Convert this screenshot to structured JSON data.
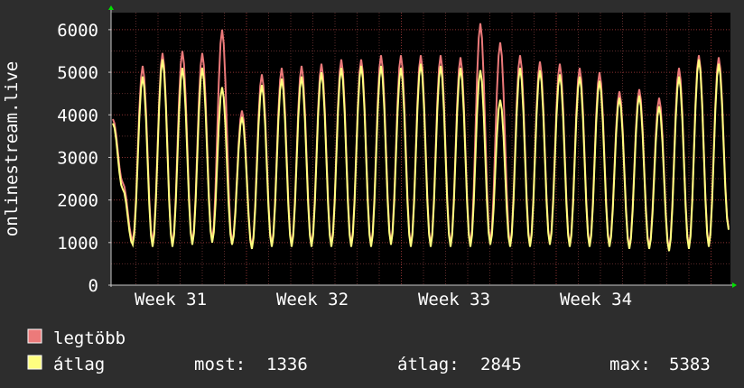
{
  "colors": {
    "background": "#2d2d2d",
    "plot_background": "#000000",
    "grid_minor": "#5a2a2a",
    "grid_major": "#8b3232",
    "max_series": "#ec7a7a",
    "avg_series": "#ffff80",
    "axis": "#c8c8c8",
    "arrow": "#00e000"
  },
  "chart_data": {
    "type": "line",
    "ylabel": "onlinestream.live",
    "ylim": [
      0,
      6400
    ],
    "yticks": [
      0,
      1000,
      2000,
      3000,
      4000,
      5000,
      6000
    ],
    "xlabels": [
      "Week 31",
      "Week 32",
      "Week 33",
      "Week 34"
    ],
    "grid": true,
    "series": [
      {
        "name": "legtöbb",
        "values": [
          3900,
          2400,
          1050,
          5150,
          1000,
          5450,
          950,
          5500,
          1000,
          5450,
          1050,
          6000,
          1000,
          4100,
          900,
          4950,
          950,
          5100,
          950,
          5150,
          950,
          5200,
          950,
          5300,
          950,
          5300,
          950,
          5400,
          1000,
          5400,
          950,
          5400,
          950,
          5400,
          950,
          5350,
          950,
          6150,
          1000,
          5700,
          950,
          5400,
          950,
          5250,
          1000,
          5200,
          950,
          5100,
          950,
          5000,
          950,
          4550,
          900,
          4600,
          900,
          4400,
          850,
          5100,
          900,
          5400,
          950,
          5350,
          1350
        ]
      },
      {
        "name": "átlag",
        "values": [
          3800,
          2250,
          950,
          4900,
          900,
          5300,
          900,
          5100,
          950,
          5100,
          1000,
          4650,
          950,
          3950,
          850,
          4700,
          900,
          4850,
          900,
          4900,
          900,
          5000,
          900,
          5100,
          900,
          5150,
          900,
          5150,
          950,
          5100,
          900,
          5200,
          900,
          5150,
          900,
          5100,
          900,
          5050,
          950,
          4350,
          900,
          5100,
          900,
          5050,
          950,
          4950,
          900,
          4900,
          900,
          4800,
          900,
          4400,
          850,
          4450,
          850,
          4200,
          800,
          4900,
          850,
          5300,
          900,
          5200,
          1300
        ]
      }
    ],
    "legend": {
      "max_label": "legtöbb",
      "avg_label": "átlag",
      "now_label": "most:",
      "now_value": "1336",
      "avg_stat_label": "átlag:",
      "avg_stat_value": "2845",
      "max_stat_label": "max:",
      "max_stat_value": "5383"
    }
  }
}
